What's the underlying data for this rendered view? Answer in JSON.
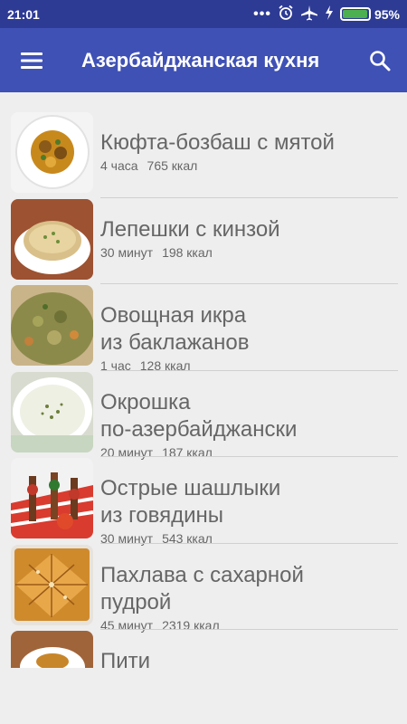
{
  "status_bar": {
    "time": "21:01",
    "dots": "•••",
    "alarm_icon": "alarm-clock-icon",
    "airplane_icon": "airplane-mode-icon",
    "charging_icon": "lightning-bolt-icon",
    "battery_level": 0.95,
    "battery_text": "95%",
    "battery_color": "#4caf50"
  },
  "app_bar": {
    "menu_icon": "hamburger-menu-icon",
    "title": "Азербайджанская кухня",
    "search_icon": "search-icon",
    "background": "#3f51b5"
  },
  "recipes": [
    {
      "line1": "Кюфта-бозбаш с мятой",
      "line2": "",
      "time": "4 часа",
      "kcal": "765 ккал"
    },
    {
      "line1": "Лепешки с кинзой",
      "line2": "",
      "time": "30 минут",
      "kcal": "198 ккал"
    },
    {
      "line1": "Овощная икра",
      "line2": "из баклажанов",
      "time": "1 час",
      "kcal": "128 ккал"
    },
    {
      "line1": "Окрошка",
      "line2": "по-азербайджански",
      "time": "20 минут",
      "kcal": "187 ккал"
    },
    {
      "line1": "Острые шашлыки",
      "line2": "из говядины",
      "time": "30 минут",
      "kcal": "543 ккал"
    },
    {
      "line1": "Пахлава с сахарной",
      "line2": "пудрой",
      "time": "45 минут",
      "kcal": "2319 ккал"
    },
    {
      "line1": "Пити",
      "line2": "",
      "time": "",
      "kcal": ""
    }
  ]
}
